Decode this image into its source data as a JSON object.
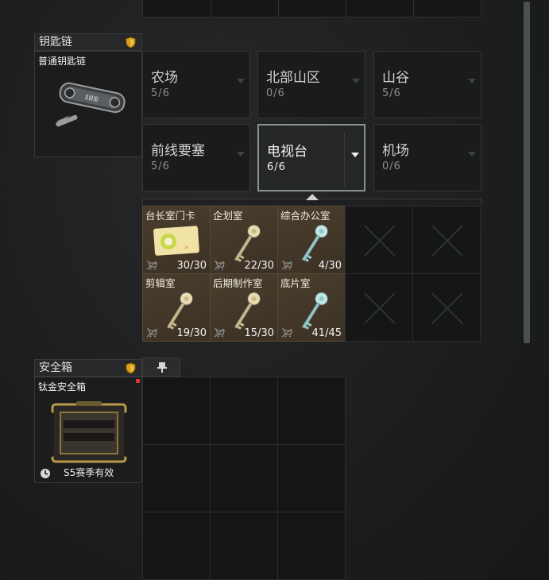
{
  "keychain": {
    "header": "钥匙链",
    "item_name": "普通钥匙链",
    "shield_icon": "shield-icon"
  },
  "maps": [
    {
      "name": "农场",
      "count": "5/6",
      "active": false
    },
    {
      "name": "北部山区",
      "count": "0/6",
      "active": false
    },
    {
      "name": "山谷",
      "count": "5/6",
      "active": false
    },
    {
      "name": "前线要塞",
      "count": "5/6",
      "active": false
    },
    {
      "name": "电视台",
      "count": "6/6",
      "active": true
    },
    {
      "name": "机场",
      "count": "0/6",
      "active": false
    }
  ],
  "keys": [
    {
      "label": "台长室门卡",
      "count": "30/30",
      "type": "card"
    },
    {
      "label": "企划室",
      "count": "22/30",
      "type": "gold"
    },
    {
      "label": "综合办公室",
      "count": "4/30",
      "type": "blue"
    },
    {
      "label": "剪辑室",
      "count": "19/30",
      "type": "gold"
    },
    {
      "label": "后期制作室",
      "count": "15/30",
      "type": "gold"
    },
    {
      "label": "底片室",
      "count": "41/45",
      "type": "blue"
    }
  ],
  "safe": {
    "header": "安全箱",
    "item_name": "钛金安全箱",
    "validity": "S5赛季有效",
    "pin_icon": "pin-icon"
  },
  "colors": {
    "shield": "#d9a21b",
    "key_bg": "#4a3d2c",
    "gold_key": "#c9b98a",
    "blue_key": "#8fc8c8"
  }
}
